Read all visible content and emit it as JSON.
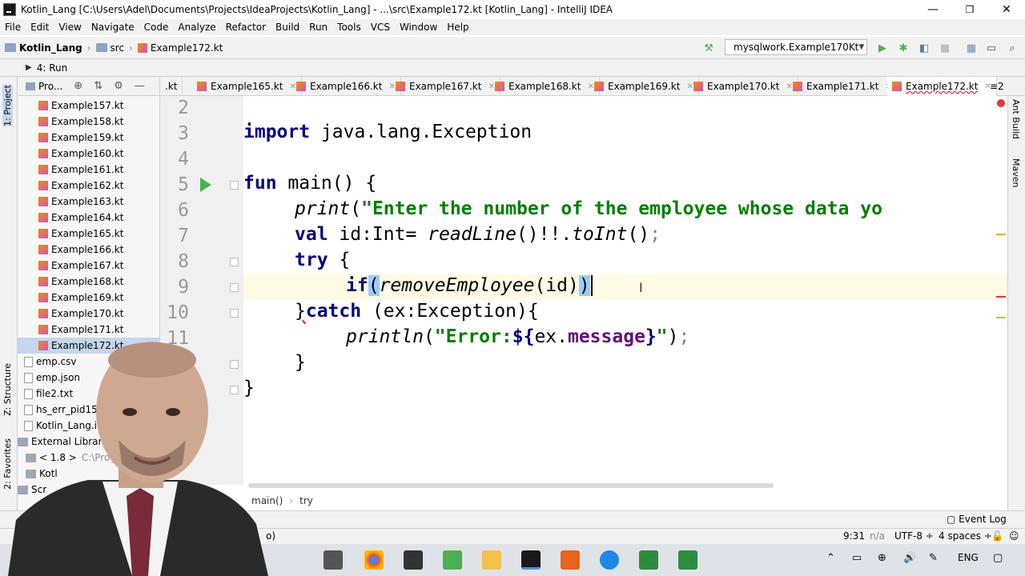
{
  "window": {
    "title": "Kotlin_Lang [C:\\Users\\Adel\\Documents\\Projects\\IdeaProjects\\Kotlin_Lang] - ...\\src\\Example172.kt [Kotlin_Lang] - IntelliJ IDEA",
    "minimize": "—",
    "restore": "❐",
    "close": "✕"
  },
  "menu": [
    "File",
    "Edit",
    "View",
    "Navigate",
    "Code",
    "Analyze",
    "Refactor",
    "Build",
    "Run",
    "Tools",
    "VCS",
    "Window",
    "Help"
  ],
  "navbar": {
    "project": "Kotlin_Lang",
    "src": "src",
    "file": "Example172.kt",
    "run_config": "mysqlwork.Example170Kt"
  },
  "runbar": {
    "label": "4: Run"
  },
  "left_tabs": {
    "project": "1: Project",
    "structure": "Z: Structure",
    "favorites": "2: Favorites"
  },
  "project_panel": {
    "header": "Pro...",
    "files": [
      "Example157.kt",
      "Example158.kt",
      "Example159.kt",
      "Example160.kt",
      "Example161.kt",
      "Example162.kt",
      "Example163.kt",
      "Example164.kt",
      "Example165.kt",
      "Example166.kt",
      "Example167.kt",
      "Example168.kt",
      "Example169.kt",
      "Example170.kt",
      "Example171.kt",
      "Example172.kt"
    ],
    "other": [
      "emp.csv",
      "emp.json",
      "file2.txt",
      "hs_err_pid1553",
      "Kotlin_Lang.iml"
    ],
    "external": "External Libraries",
    "jdk": "< 1.8 >",
    "jdk_path": "C:\\Progr",
    "kotlin": "Kotl",
    "scratches": "Scr"
  },
  "tabs": [
    {
      "label": ".kt"
    },
    {
      "label": "Example165.kt"
    },
    {
      "label": "Example166.kt"
    },
    {
      "label": "Example167.kt"
    },
    {
      "label": "Example168.kt"
    },
    {
      "label": "Example169.kt"
    },
    {
      "label": "Example170.kt"
    },
    {
      "label": "Example171.kt"
    },
    {
      "label": "Example172.kt"
    }
  ],
  "tabs_overflow": "≡2",
  "code": {
    "line_numbers": [
      "2",
      "3",
      "4",
      "5",
      "6",
      "7",
      "8",
      "9",
      "10",
      "11"
    ],
    "l3_kw": "import",
    "l3_rest": " java.lang.Exception",
    "l5_kw": "fun",
    "l5_rest": " main() {",
    "l6_fn": "print",
    "l6_open": "(",
    "l6_str": "\"Enter the number of the employee whose data yo",
    "l7_kw": "val",
    "l7_mid": " id:Int= ",
    "l7_fn1": "readLine",
    "l7_mid2": "()!!.",
    "l7_fn2": "toInt",
    "l7_end": "()",
    "l7_semi": ";",
    "l8_kw": "try",
    "l8_rest": " {",
    "l9_kw": "if",
    "l9_open": "(",
    "l9_fn": "removeEmployee",
    "l9_mid": "(id)",
    "l9_close": ")",
    "l10_brace": "}",
    "l10_kw": "catch",
    "l10_rest": " (ex:Exception){",
    "l11_fn": "println",
    "l11_open": "(",
    "l11_str1": "\"Error:",
    "l11_tmpl1": "${",
    "l11_ex": "ex.",
    "l11_prop": "message",
    "l11_tmpl2": "}",
    "l11_str2": "\"",
    "l11_close": ")",
    "l11_semi": ";",
    "l12": "}",
    "l13": "}"
  },
  "right_tabs": {
    "ant": "Ant Build",
    "maven": "Maven"
  },
  "breadcrumbs": {
    "fn": "main()",
    "block": "try"
  },
  "event_log": "Event Log",
  "status": {
    "left": "o)",
    "position": "9:31",
    "na": "n/a",
    "encoding": "UTF-8 ÷",
    "indent": "4 spaces ÷"
  },
  "taskbar": {
    "lang": "ENG"
  },
  "colors": {
    "keyword": "#000080",
    "string": "#008000",
    "property": "#660e7a",
    "selection": "#c6d6ec",
    "bracket_highlight": "#99ccff"
  }
}
